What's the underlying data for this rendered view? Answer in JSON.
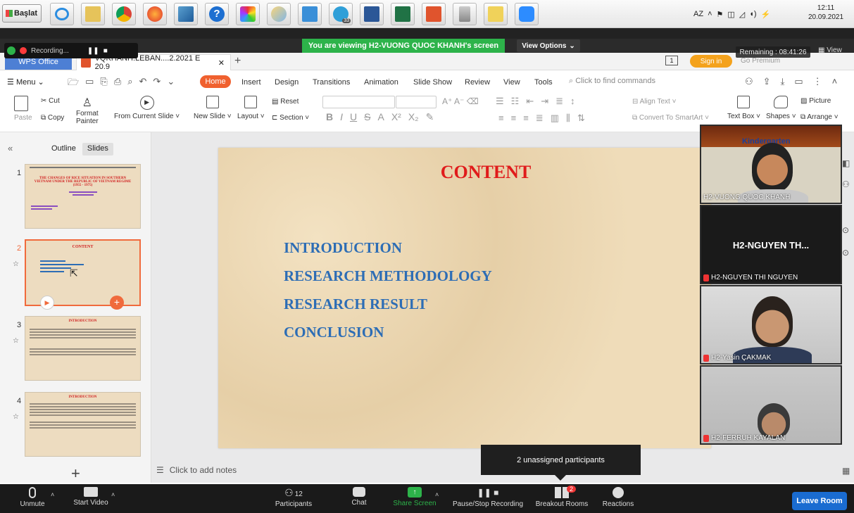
{
  "taskbar": {
    "start_label": "Başlat",
    "apps": [
      "ie-icon",
      "explorer-icon",
      "chrome-icon",
      "firefox-icon",
      "sticky-icon",
      "help-icon",
      "paint-icon",
      "brush-icon",
      "window-icon",
      "telegram-icon",
      "word-icon",
      "excel-icon",
      "wps-icon",
      "recycle-icon",
      "folder-icon",
      "zoom-icon"
    ],
    "telegram_badge": "33",
    "language": "AZ",
    "time": "12:11",
    "date": "20.09.2021"
  },
  "zoom_top": {
    "recording_label": "Recording...",
    "viewing_text": "You are viewing H2-VUONG QUOC KHANH's screen",
    "view_options": "View Options",
    "remaining": "Remaining : 08:41:26",
    "view_label": "View"
  },
  "wps": {
    "app_tab": "WPS Office",
    "doc_tab": "VQKHANH.LEBAN....2.2021 E 20.9",
    "sign_in": "Sign in",
    "go_premium": "Go Premium",
    "menu_label": "Menu",
    "tabs": [
      "Home",
      "Insert",
      "Design",
      "Transitions",
      "Animation",
      "Slide Show",
      "Review",
      "View",
      "Tools"
    ],
    "search_placeholder": "Click to find commands",
    "ribbon": {
      "paste": "Paste",
      "cut": "Cut",
      "copy": "Copy",
      "format_painter_1": "Format",
      "format_painter_2": "Painter",
      "from_current": "From Current Slide",
      "new_slide": "New Slide",
      "layout": "Layout",
      "reset": "Reset",
      "section": "Section",
      "align_text": "Align Text",
      "convert_smartart": "Convert To SmartArt",
      "text_box": "Text Box",
      "shapes": "Shapes",
      "picture": "Picture",
      "arrange": "Arrange"
    },
    "panel_tabs": [
      "Outline",
      "Slides"
    ],
    "thumbnails": [
      {
        "num": "1",
        "title": "THE CHANGES OF RICE SITUATION IN SOUTHERN VIETNAM UNDER THE REPUBLIC OF VIETNAM REGIME (1955 - 1975)"
      },
      {
        "num": "2",
        "title": "CONTENT"
      },
      {
        "num": "3",
        "title": "INTRODUCTION"
      },
      {
        "num": "4",
        "title": "INTRODUCTION"
      }
    ],
    "notes_placeholder": "Click to add notes"
  },
  "slide": {
    "title": "CONTENT",
    "items": [
      "INTRODUCTION",
      "RESEARCH METHODOLOGY",
      "RESEARCH RESULT",
      "CONCLUSION"
    ]
  },
  "participants_tiles": [
    {
      "name": "H2-VUONG QUOC KHANH",
      "muted": false,
      "header_text": "Kindergarten"
    },
    {
      "name": "H2-NGUYEN THI NGUYEN",
      "muted": true,
      "big_name": "H2-NGUYEN TH..."
    },
    {
      "name": "H2-Yasin ÇAKMAK",
      "muted": true
    },
    {
      "name": "H2-FERRUH KAYALAN",
      "muted": true
    }
  ],
  "tooltip": "2 unassigned participants",
  "bottom_bar": {
    "unmute": "Unmute",
    "start_video": "Start Video",
    "participants": "Participants",
    "participants_count": "12",
    "chat": "Chat",
    "share_screen": "Share Screen",
    "pause_recording": "Pause/Stop Recording",
    "breakout_rooms": "Breakout Rooms",
    "breakout_badge": "2",
    "reactions": "Reactions",
    "leave_room": "Leave Room"
  },
  "colors": {
    "zoom_green": "#2db34a",
    "wps_orange": "#f0612f",
    "slide_title_red": "#e01b1b",
    "slide_item_blue": "#2d6db5",
    "leave_blue": "#1a6cd1"
  }
}
